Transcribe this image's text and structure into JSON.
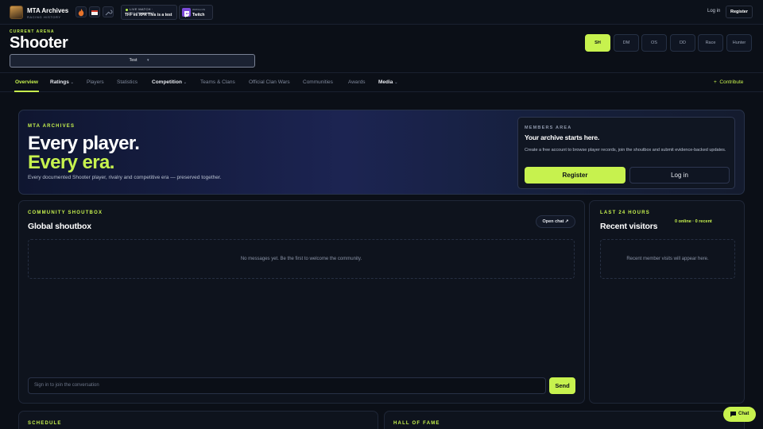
{
  "header": {
    "brand_title": "MTA Archives",
    "brand_subtitle": "RACING HISTORY",
    "live": {
      "label": "LIVE MATCH · TOURNAMENT",
      "text": "TFF vs XPR This is a test"
    },
    "twitch": {
      "sub": "WATCH ON",
      "name": "Twitch"
    },
    "login_label": "Log in",
    "register_label": "Register"
  },
  "arena": {
    "label": "CURRENT ARENA",
    "title": "Shooter",
    "selected": "Test"
  },
  "modes": [
    "SH",
    "DM",
    "OS",
    "DD",
    "Race",
    "Hunter"
  ],
  "nav": {
    "items": [
      "Overview",
      "Ratings",
      "Players",
      "Statistics",
      "Competition",
      "Teams & Clans",
      "Official Clan Wars",
      "Communities",
      "Awards",
      "Media"
    ],
    "contribute": "Contribute"
  },
  "hero": {
    "label": "MTA ARCHIVES",
    "line1": "Every player.",
    "line2": "Every era.",
    "description": "Every documented Shooter player, rivalry and competitive era — preserved together."
  },
  "members": {
    "label": "MEMBERS AREA",
    "title": "Your archive starts here.",
    "description": "Create a free account to browse player records, join the shoutbox and submit evidence-backed updates.",
    "register_label": "Register",
    "login_label": "Log in"
  },
  "shoutbox": {
    "label": "COMMUNITY SHOUTBOX",
    "title": "Global shoutbox",
    "open_chat": "Open chat ↗",
    "empty": "No messages yet. Be the first to welcome the community.",
    "input_placeholder": "Sign in to join the conversation",
    "send_label": "Send"
  },
  "visitors": {
    "label": "LAST 24 HOURS",
    "title": "Recent visitors",
    "counts": "0 online · 0 recent",
    "empty": "Recent member visits will appear here."
  },
  "schedule": {
    "label": "SCHEDULE"
  },
  "hall_of_fame": {
    "label": "HALL OF FAME"
  },
  "chat_fab": {
    "label": "Chat"
  },
  "colors": {
    "accent": "#c7f24e",
    "background": "#0b0f17",
    "twitch": "#7b4ad8"
  }
}
